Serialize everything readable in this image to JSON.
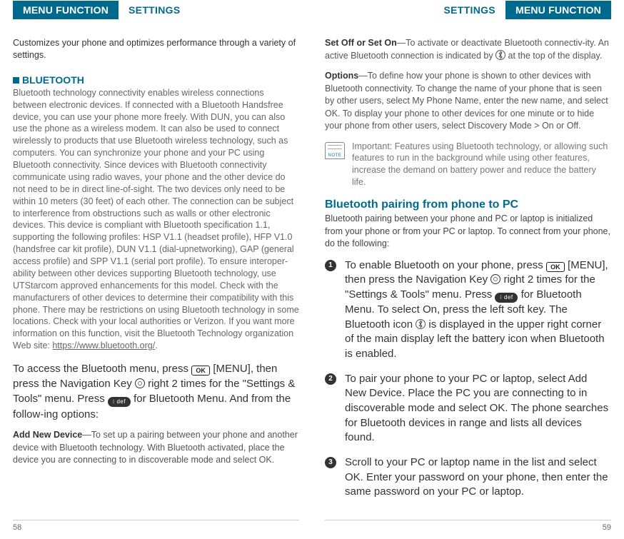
{
  "leftHeader": {
    "tab": "MENU FUNCTION",
    "text": "SETTINGS"
  },
  "rightHeader": {
    "text": "SETTINGS",
    "tab": "MENU FUNCTION"
  },
  "leftPage": {
    "intro": "Customizes your phone and optimizes performance through a variety of settings.",
    "sectionTitle": "BLUETOOTH",
    "bluetoothBody": "Bluetooth technology connectivity enables wireless connections between electronic devices. If connected with a Bluetooth Handsfree device, you can use your phone more freely. With DUN, you can also use the phone as a wireless modem. It can also be used to connect wirelessly to products that use Bluetooth wireless technology, such as computers. You can synchronize your phone and your PC using Bluetooth connectivity. Since devices with Bluetooth connectivity communicate using radio waves, your phone and the other device do not need to be in direct line-of-sight. The two devices only need to be within 10 meters (30 feet) of each other. The connection can be subject to interference from obstructions such as walls or other electronic devices.  This device is compliant with Bluetooth specification 1.1, supporting the following profiles: HSP V1.1 (headset profile), HFP V1.0 (handsfree car kit profile), DUN V1.1 (dial-upnetworking), GAP (general access profile) and SPP V1.1 (serial port profile). To ensure interoper-ability between other devices supporting Bluetooth technology, use UTStarcom approved enhancements for this model. Check with the manufacturers of other devices to determine their compatibility with this phone. There may be restrictions on using Bluetooth technology in some locations. Check with your local authorities or Verizon. If you want more information on this function, visit the Bluetooth Technology organization Web site: ",
    "bluetoothURL": "https://www.bluetooth.org/",
    "access_1": "To access the Bluetooth menu, press ",
    "access_2": " [MENU], then press the Navigation Key ",
    "access_3": " right 2 times for the \"Settings & Tools\" menu. Press ",
    "access_4": " for Bluetooth Menu. And from the follow-ing options:",
    "addNewLabel": "Add New Device",
    "addNewBody": "—To set up a pairing between your phone and another device with Bluetooth technology. With Bluetooth activated, place the device you are connecting to in discoverable mode and select OK.",
    "pageNum": "58",
    "okLabel": "OK",
    "btnDef": "⁝ def"
  },
  "rightPage": {
    "setLabel": "Set Off or Set On",
    "setBody": "—To activate or deactivate Bluetooth connectiv-ity. An active Bluetooth connection is indicated by ",
    "setBody2": " at the top of the display.",
    "optionsLabel": "Options",
    "optionsBody": "—To define how your phone is shown to other devices with Bluetooth connectivity. To change the name of your phone that is seen by other users, select My Phone Name, enter the new name, and select OK. To display your phone to other devices for one minute or to hide your phone from other users, select Discovery Mode > On or Off.",
    "noteText": "Important: Features using Bluetooth technology, or allowing such features to run in the background while using other features, increase the demand on battery power and reduce the battery life.",
    "pairTitle": "Bluetooth pairing from phone to PC",
    "pairIntro": "Bluetooth pairing between your phone and PC or laptop is initialized from your phone or from your PC or laptop. To connect from your phone, do the following:",
    "step1_a": "To enable Bluetooth on your phone, press ",
    "step1_b": " [MENU], then press the Navigation Key ",
    "step1_c": " right 2 times for the \"Settings & Tools\" menu. Press ",
    "step1_d": " for Bluetooth Menu. To select On, press the left soft key.  The Bluetooth icon ",
    "step1_e": " is displayed in the upper right corner of the main display left the battery icon when Bluetooth is enabled.",
    "step2": "To pair your phone to your PC or laptop, select Add New Device. Place the PC you are connecting to in discoverable mode and select OK. The phone searches for Bluetooth devices in range and lists all devices found.",
    "step3": "Scroll to your PC or laptop name in the list and select OK. Enter your password on your phone, then enter the same password on your PC or laptop.",
    "pageNum": "59",
    "okLabel": "OK",
    "btnDef": "⁝ def"
  }
}
